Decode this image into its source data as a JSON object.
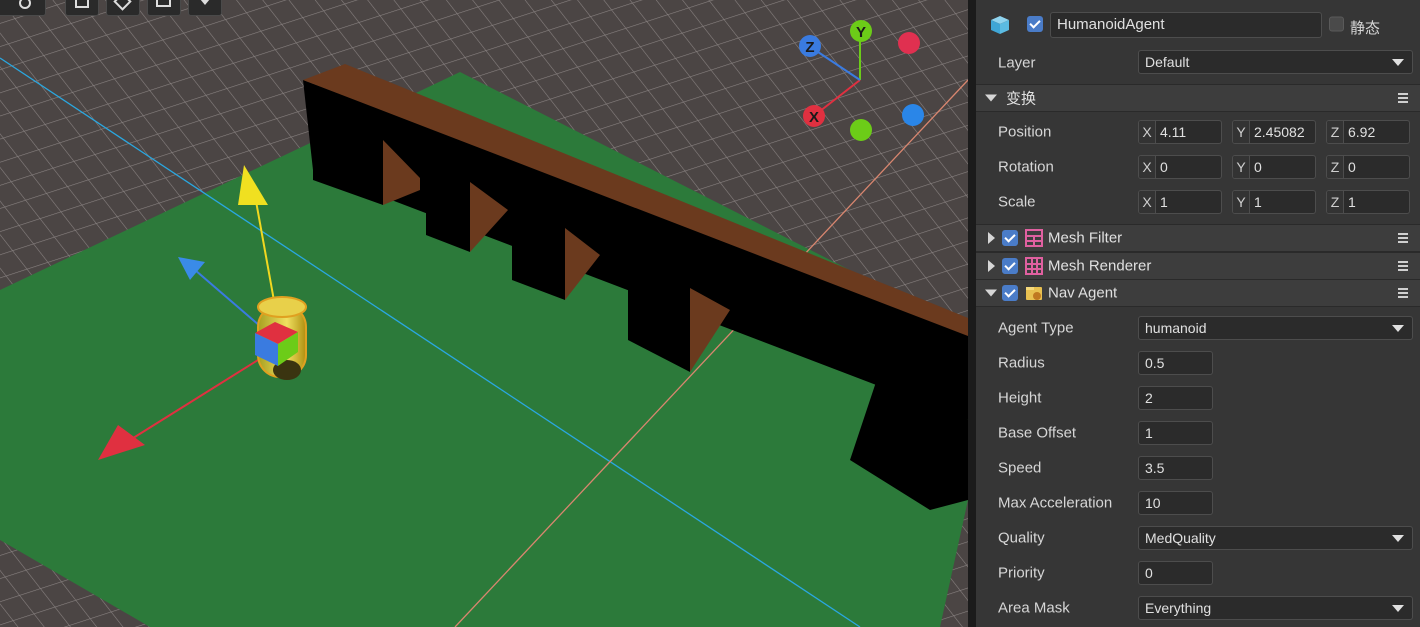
{
  "colors": {
    "ground": "#4b4544",
    "grass": "#2c7a3a",
    "wall_top": "#6b3a1e",
    "accent_check": "#4a7cc8",
    "gizmo_x": "#e03040",
    "gizmo_y": "#f0d820",
    "gizmo_z": "#3a7be0",
    "gizmo_green": "#6ccc18"
  },
  "viewport": {
    "gizmo_labels": {
      "x": "X",
      "y": "Y",
      "z": "Z"
    }
  },
  "inspector": {
    "object": {
      "name": "HumanoidAgent",
      "static_label": "静态",
      "icon": "cube-icon"
    },
    "layer": {
      "label": "Layer",
      "value": "Default"
    },
    "transform": {
      "title": "变换",
      "position": {
        "label": "Position",
        "x": "4.11",
        "y": "2.45082",
        "z": "6.92"
      },
      "rotation": {
        "label": "Rotation",
        "x": "0",
        "y": "0",
        "z": "0"
      },
      "scale": {
        "label": "Scale",
        "x": "1",
        "y": "1",
        "z": "1"
      },
      "axis_x": "X",
      "axis_y": "Y",
      "axis_z": "Z"
    },
    "components": [
      {
        "title": "Mesh Filter",
        "icon": "mesh-filter-icon"
      },
      {
        "title": "Mesh Renderer",
        "icon": "mesh-renderer-icon"
      },
      {
        "title": "Nav Agent",
        "icon": "nav-agent-icon"
      }
    ],
    "nav_agent": {
      "agent_type": {
        "label": "Agent Type",
        "value": "humanoid"
      },
      "radius": {
        "label": "Radius",
        "value": "0.5"
      },
      "height": {
        "label": "Height",
        "value": "2"
      },
      "base_offset": {
        "label": "Base Offset",
        "value": "1"
      },
      "speed": {
        "label": "Speed",
        "value": "3.5"
      },
      "max_acceleration": {
        "label": "Max Acceleration",
        "value": "10"
      },
      "quality": {
        "label": "Quality",
        "value": "MedQuality"
      },
      "priority": {
        "label": "Priority",
        "value": "0"
      },
      "area_mask": {
        "label": "Area Mask",
        "value": "Everything"
      }
    }
  }
}
